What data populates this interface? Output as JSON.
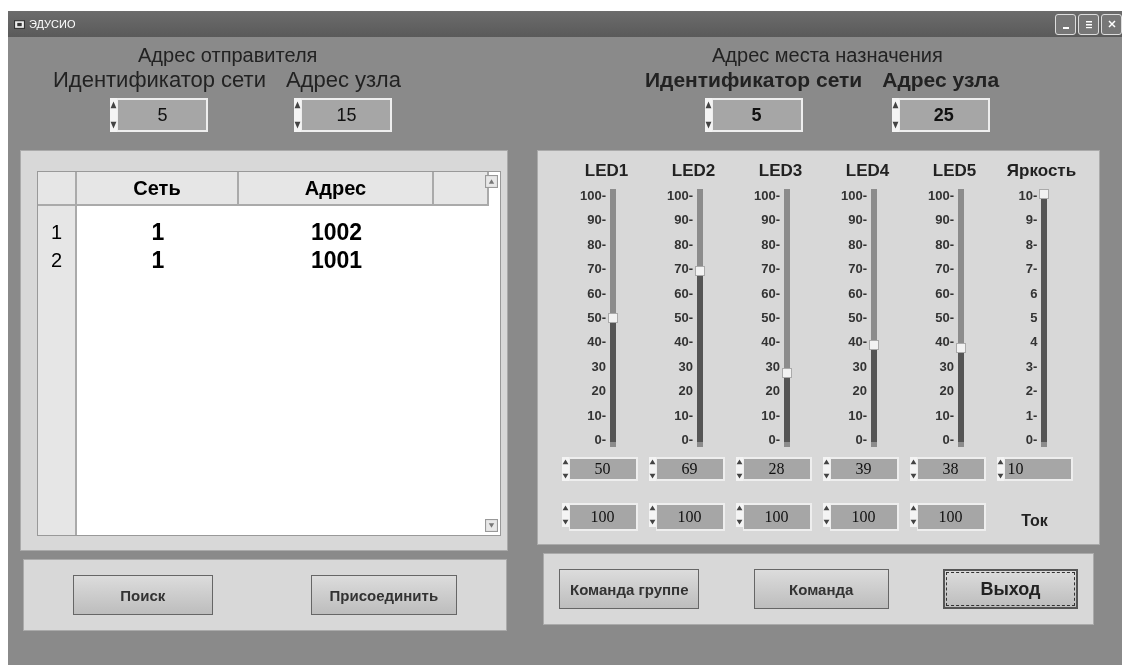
{
  "window": {
    "title": "ЭДУСИО"
  },
  "sender": {
    "title": "Адрес отправителя",
    "fields": [
      {
        "label": "Идентификатор сети",
        "value": "5"
      },
      {
        "label": "Адрес узла",
        "value": "15"
      }
    ]
  },
  "destination": {
    "title": "Адрес места назначения",
    "fields": [
      {
        "label": "Идентификатор сети",
        "value": "5"
      },
      {
        "label": "Адрес узла",
        "value": "25"
      }
    ]
  },
  "table": {
    "columns": [
      "Сеть",
      "Адрес"
    ],
    "rows": [
      {
        "index": "1",
        "cells": [
          "1",
          "1002"
        ]
      },
      {
        "index": "2",
        "cells": [
          "1",
          "1001"
        ]
      }
    ]
  },
  "sliders": [
    {
      "label": "LED1",
      "level": 0.5,
      "ticks": [
        "100-",
        "90-",
        "80-",
        "70-",
        "60-",
        "50-",
        "40-",
        "30",
        "20",
        "10-",
        "0-"
      ],
      "value": "50",
      "current": "100"
    },
    {
      "label": "LED2",
      "level": 0.69,
      "ticks": [
        "100-",
        "90-",
        "80-",
        "70-",
        "60-",
        "50-",
        "40-",
        "30",
        "20",
        "10-",
        "0-"
      ],
      "value": "69",
      "current": "100"
    },
    {
      "label": "LED3",
      "level": 0.28,
      "ticks": [
        "100-",
        "90-",
        "80-",
        "70-",
        "60-",
        "50-",
        "40-",
        "30",
        "20",
        "10-",
        "0-"
      ],
      "value": "28",
      "current": "100"
    },
    {
      "label": "LED4",
      "level": 0.39,
      "ticks": [
        "100-",
        "90-",
        "80-",
        "70-",
        "60-",
        "50-",
        "40-",
        "30",
        "20",
        "10-",
        "0-"
      ],
      "value": "39",
      "current": "100"
    },
    {
      "label": "LED5",
      "level": 0.38,
      "ticks": [
        "100-",
        "90-",
        "80-",
        "70-",
        "60-",
        "50-",
        "40-",
        "30",
        "20",
        "10-",
        "0-"
      ],
      "value": "38",
      "current": "100"
    },
    {
      "label": "Яркость",
      "level": 1.0,
      "ticks": [
        "10-",
        "9-",
        "8-",
        "7-",
        "6",
        "5",
        "4",
        "3-",
        "2-",
        "1-",
        "0-"
      ],
      "value": "10"
    }
  ],
  "current_label": "Ток",
  "left_buttons": [
    {
      "label": "Поиск",
      "focused": false
    },
    {
      "label": "Присоединить",
      "focused": false
    }
  ],
  "right_buttons": [
    {
      "label": "Команда группе",
      "focused": false
    },
    {
      "label": "Команда",
      "focused": false
    },
    {
      "label": "Выход",
      "focused": true
    }
  ]
}
